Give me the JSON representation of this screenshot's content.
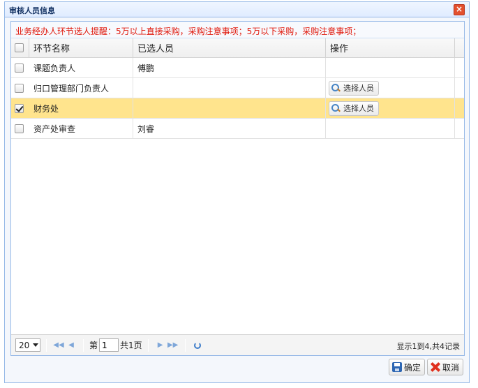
{
  "dialog": {
    "title": "审核人员信息",
    "close_glyph": "×"
  },
  "notice": "业务经办人环节选人提醒：5万以上直接采购，采购注意事项；5万以下采购，采购注意事项；",
  "table": {
    "columns": [
      "环节名称",
      "已选人员",
      "操作"
    ],
    "rows": [
      {
        "name": "课题负责人",
        "person": "傅鹏",
        "checked": false,
        "has_action": false
      },
      {
        "name": "归口管理部门负责人",
        "person": "",
        "checked": false,
        "has_action": true
      },
      {
        "name": "财务处",
        "person": "",
        "checked": true,
        "has_action": true,
        "selected": true
      },
      {
        "name": "资产处审查",
        "person": "刘睿",
        "checked": false,
        "has_action": false
      }
    ],
    "action_label": "选择人员"
  },
  "pager": {
    "page_size": "20",
    "page_prefix": "第",
    "current_page": "1",
    "total_pages": "共1页",
    "info": "显示1到4,共4记录"
  },
  "buttons": {
    "confirm": "确定",
    "cancel": "取消"
  },
  "colors": {
    "selected_row": "#ffe48d",
    "notice_text": "#e0170a",
    "border": "#95b8e7"
  }
}
